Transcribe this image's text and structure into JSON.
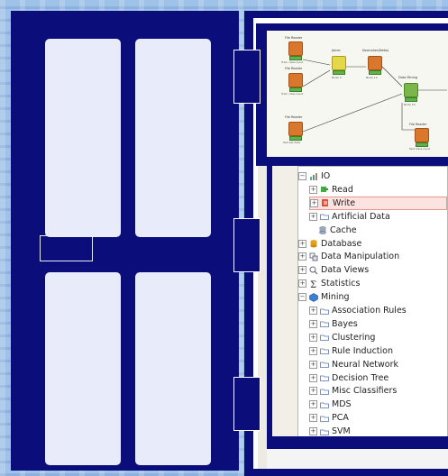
{
  "workflow": {
    "nodes": [
      {
        "title": "File Reader",
        "sub": "Train class input",
        "color": "orange"
      },
      {
        "title": "File Reader",
        "sub": "Train class input",
        "color": "orange"
      },
      {
        "title": "Joiner",
        "sub": "Node 3",
        "color": "yellow"
      },
      {
        "title": "Normalize(Netw)",
        "sub": "Node 14",
        "color": "orange"
      },
      {
        "title": "Data Mining",
        "sub": "Node 19",
        "color": "green"
      },
      {
        "title": "File Reader",
        "sub": "Test set data",
        "color": "orange"
      },
      {
        "title": "File Reader",
        "sub": "Test class input",
        "color": "orange"
      }
    ]
  },
  "tree": {
    "items": [
      {
        "label": "IO",
        "level": 0,
        "exp": "−",
        "icon": "io-icon"
      },
      {
        "label": "Read",
        "level": 1,
        "exp": "+",
        "icon": "read-icon"
      },
      {
        "label": "Write",
        "level": 1,
        "exp": "+",
        "icon": "write-icon",
        "selected": true
      },
      {
        "label": "Artificial Data",
        "level": 1,
        "exp": "+",
        "icon": "folder-icon"
      },
      {
        "label": "Cache",
        "level": 1,
        "exp": "",
        "icon": "cache-icon"
      },
      {
        "label": "Database",
        "level": 0,
        "exp": "+",
        "icon": "database-icon"
      },
      {
        "label": "Data Manipulation",
        "level": 0,
        "exp": "+",
        "icon": "data-manipulation-icon"
      },
      {
        "label": "Data Views",
        "level": 0,
        "exp": "+",
        "icon": "data-views-icon"
      },
      {
        "label": "Statistics",
        "level": 0,
        "exp": "+",
        "icon": "statistics-icon"
      },
      {
        "label": "Mining",
        "level": 0,
        "exp": "−",
        "icon": "mining-icon"
      },
      {
        "label": "Association Rules",
        "level": 1,
        "exp": "+",
        "icon": "folder-icon"
      },
      {
        "label": "Bayes",
        "level": 1,
        "exp": "+",
        "icon": "folder-icon"
      },
      {
        "label": "Clustering",
        "level": 1,
        "exp": "+",
        "icon": "folder-icon"
      },
      {
        "label": "Rule Induction",
        "level": 1,
        "exp": "+",
        "icon": "folder-icon"
      },
      {
        "label": "Neural Network",
        "level": 1,
        "exp": "+",
        "icon": "folder-icon"
      },
      {
        "label": "Decision Tree",
        "level": 1,
        "exp": "+",
        "icon": "folder-icon"
      },
      {
        "label": "Misc Classifiers",
        "level": 1,
        "exp": "+",
        "icon": "folder-icon"
      },
      {
        "label": "MDS",
        "level": 1,
        "exp": "+",
        "icon": "folder-icon"
      },
      {
        "label": "PCA",
        "level": 1,
        "exp": "+",
        "icon": "folder-icon"
      },
      {
        "label": "SVM",
        "level": 1,
        "exp": "+",
        "icon": "folder-icon"
      }
    ]
  },
  "colors": {
    "cabinet": "#0b0e7a",
    "panel": "#e8ebfa",
    "selection": "#fde3e0"
  }
}
